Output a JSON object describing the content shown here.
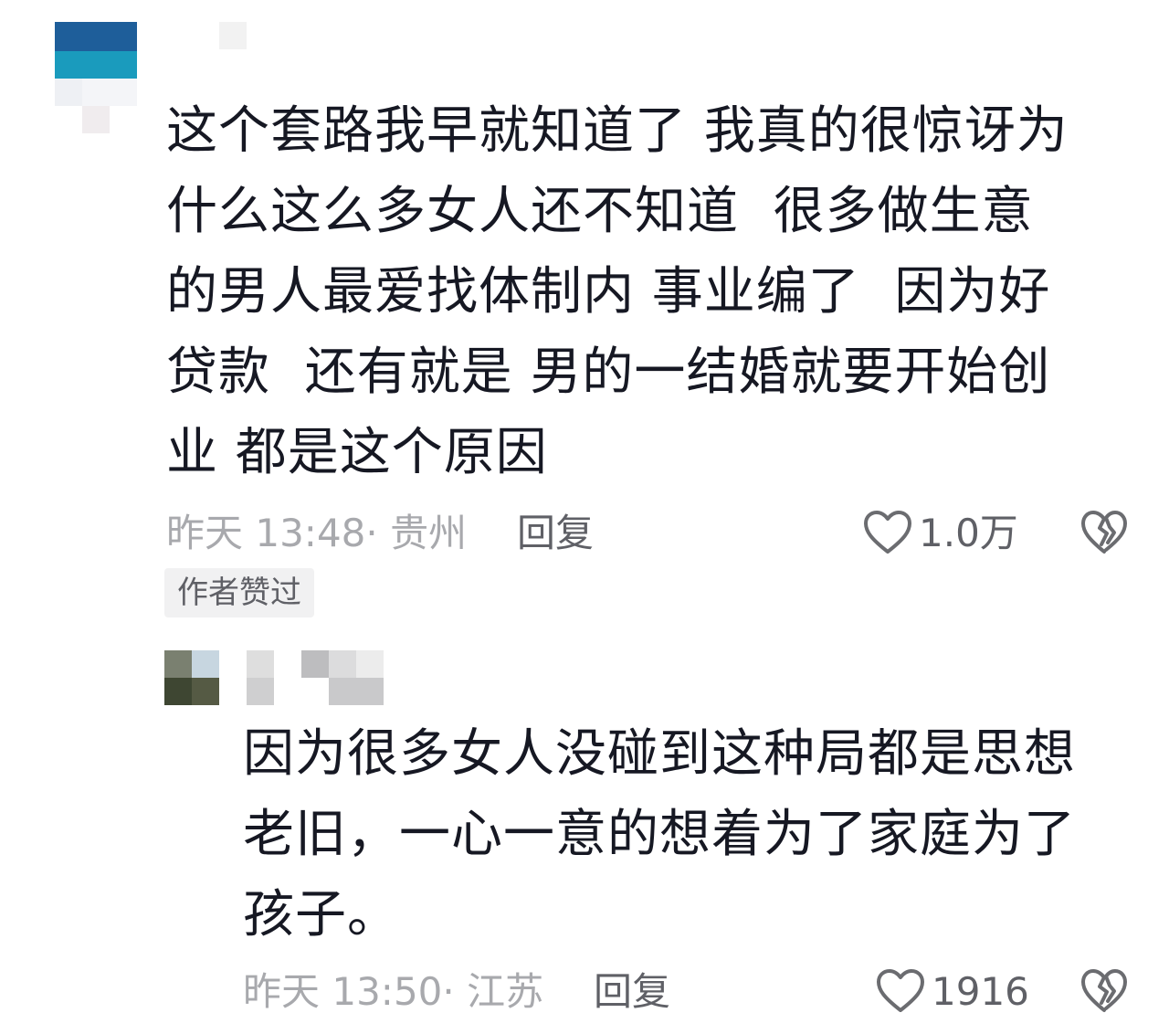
{
  "comment1": {
    "lines": [
      "这个套路我早就知道了 我真的很惊讶为",
      "什么这么多女人还不知道  很多做生意",
      "的男人最爱找体制内 事业编了  因为好",
      "贷款  还有就是 男的一结婚就要开始创",
      "业 都是这个原因"
    ],
    "time": "昨天 13:48",
    "location": "· 贵州",
    "reply_label": "回复",
    "like_count": "1.0万",
    "author_badge": "作者赞过",
    "icons": {
      "like": "heart-icon",
      "dislike": "broken-heart-icon"
    }
  },
  "comment2": {
    "lines": [
      "因为很多女人没碰到这种局都是思想",
      "老旧，一心一意的想着为了家庭为了",
      "孩子。"
    ],
    "time": "昨天 13:50",
    "location": "· 江苏",
    "reply_label": "回复",
    "like_count": "1916",
    "icons": {
      "like": "heart-icon",
      "dislike": "broken-heart-icon"
    }
  },
  "colors": {
    "text_primary": "#161823",
    "text_meta": "#a8a9ad",
    "text_secondary": "#5f6066",
    "badge_bg": "#f1f1f2",
    "icon_stroke": "#6b6c70"
  }
}
